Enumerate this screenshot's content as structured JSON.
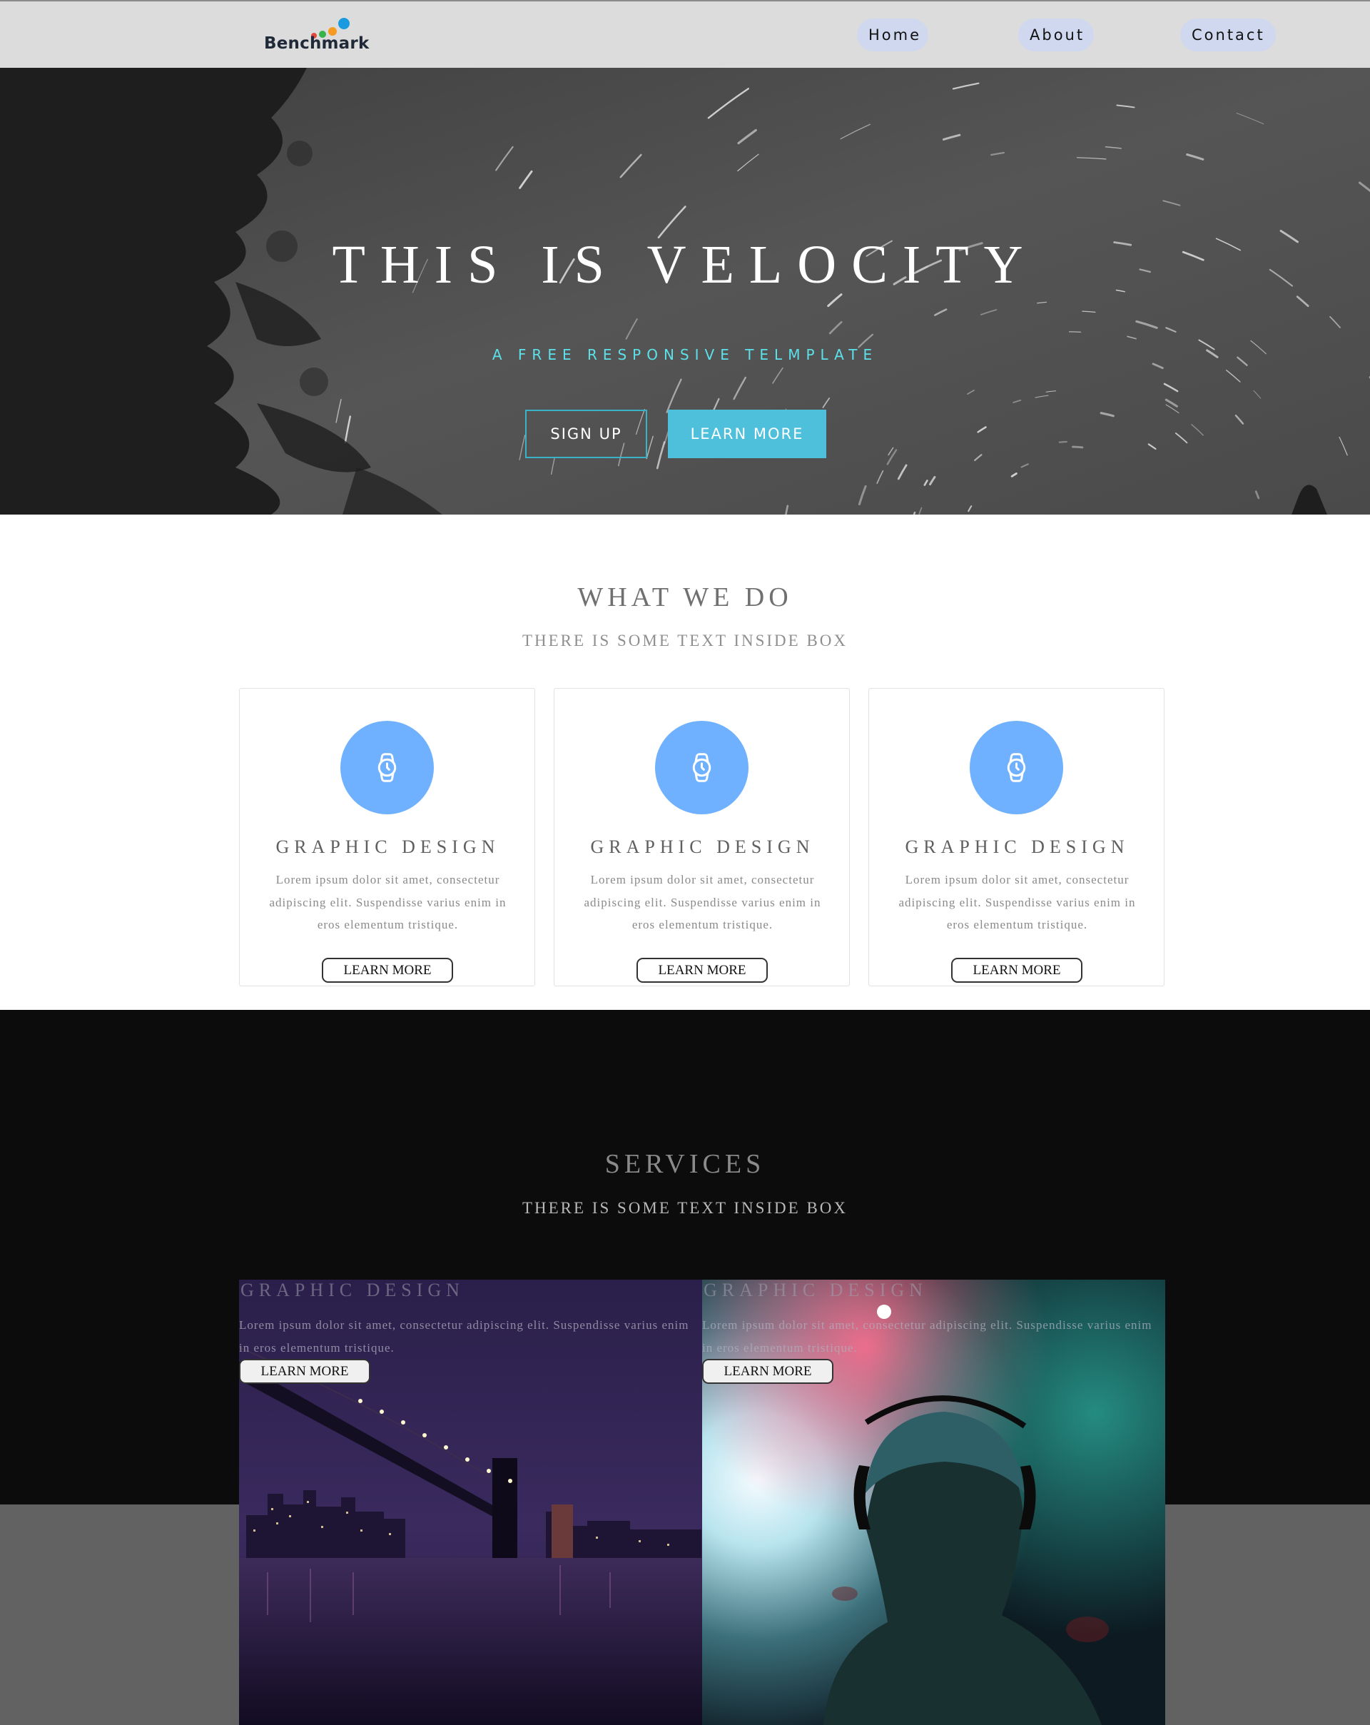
{
  "nav": {
    "logo_text": "Benchmark",
    "links": [
      "Home",
      "About",
      "Contact"
    ]
  },
  "hero": {
    "title": "THIS IS VELOCITY",
    "subtitle": "A FREE RESPONSIVE TELMPLATE",
    "signup_label": "SIGN UP",
    "learn_label": "LEARN MORE"
  },
  "what_we_do": {
    "title": "WHAT WE DO",
    "subtitle": "THERE IS SOME TEXT INSIDE BOX",
    "cards": [
      {
        "icon": "watch-icon",
        "title": "GRAPHIC DESIGN",
        "text": "Lorem ipsum dolor sit amet, consectetur adipiscing elit. Suspendisse varius enim in eros elementum tristique.",
        "button": "LEARN MORE"
      },
      {
        "icon": "watch-icon",
        "title": "GRAPHIC DESIGN",
        "text": "Lorem ipsum dolor sit amet, consectetur adipiscing elit. Suspendisse varius enim in eros elementum tristique.",
        "button": "LEARN MORE"
      },
      {
        "icon": "watch-icon",
        "title": "GRAPHIC DESIGN",
        "text": "Lorem ipsum dolor sit amet, consectetur adipiscing elit. Suspendisse varius enim in eros elementum tristique.",
        "button": "LEARN MORE"
      }
    ]
  },
  "services": {
    "title": "SERVICES",
    "subtitle": "THERE IS SOME TEXT INSIDE BOX",
    "panels": [
      {
        "title": "GRAPHIC DESIGN",
        "text": "Lorem ipsum dolor sit amet, consectetur adipiscing elit. Suspendisse varius enim in eros elementum tristique.",
        "button": "LEARN MORE"
      },
      {
        "title": "GRAPHIC DESIGN",
        "text": "Lorem ipsum dolor sit amet, consectetur adipiscing elit. Suspendisse varius enim in eros elementum tristique.",
        "button": "LEARN MORE"
      }
    ]
  },
  "colors": {
    "accent": "#4ec0dc",
    "subtitle": "#5ce1ea",
    "icon_circle": "#6fb1ff",
    "nav_bg": "#dcdcdc",
    "services_bg": "#0c0c0c"
  }
}
